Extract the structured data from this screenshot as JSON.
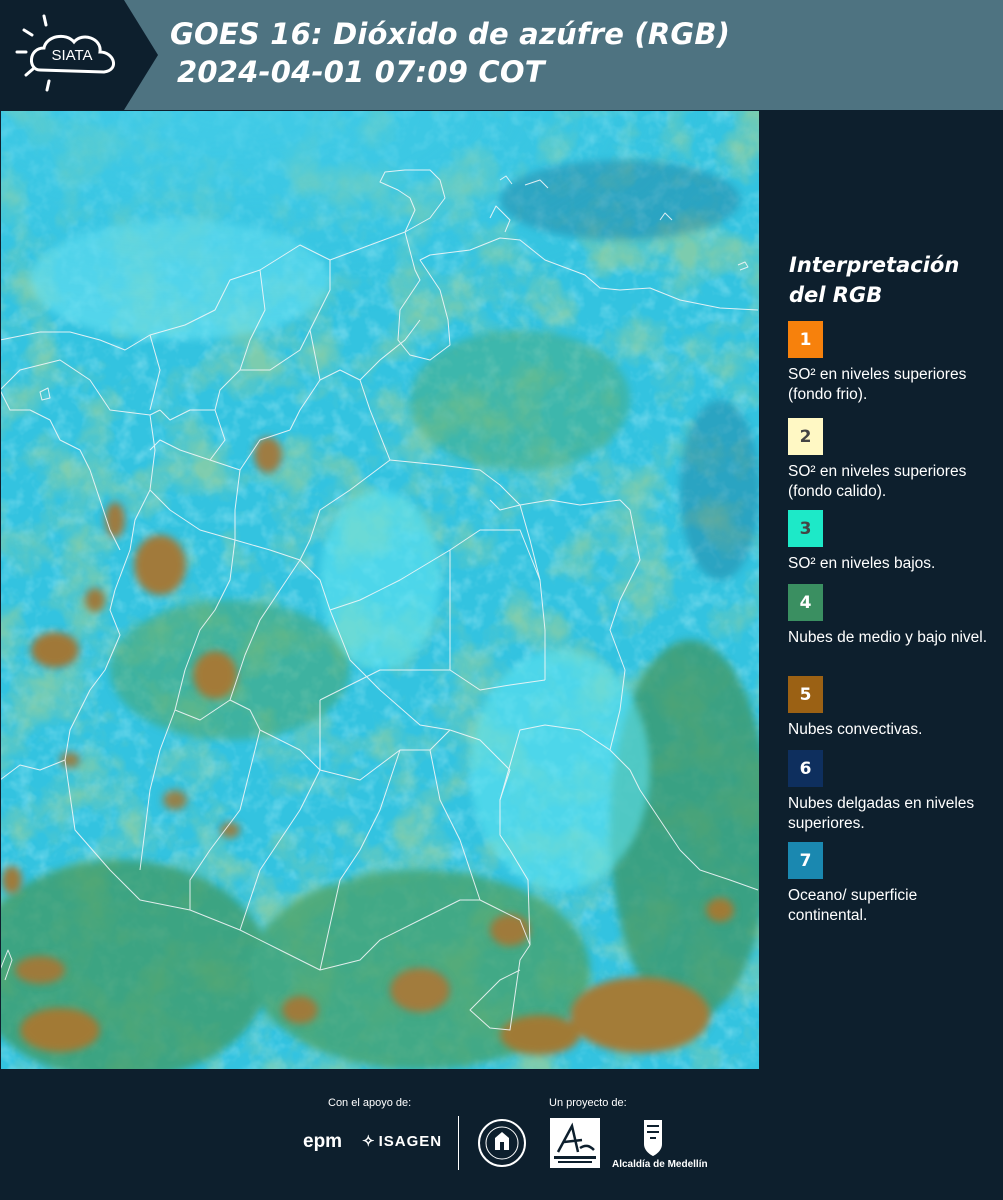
{
  "header": {
    "logo_text": "SIATA",
    "title_line1": "GOES 16: Dióxido de azúfre (RGB)",
    "title_line2": "2024-04-01 07:09 COT"
  },
  "legend": {
    "title": "Interpretación del RGB",
    "items": [
      {
        "number": "1",
        "color": "#f7810c",
        "text": "SO² en niveles superiores (fondo frio)."
      },
      {
        "number": "2",
        "color": "#fff8c4",
        "text": "SO² en niveles superiores (fondo calido)."
      },
      {
        "number": "3",
        "color": "#1de9c8",
        "text": "SO² en niveles bajos."
      },
      {
        "number": "4",
        "color": "#3a8f61",
        "text": "Nubes de medio y bajo nivel."
      },
      {
        "number": "5",
        "color": "#9b6114",
        "text": "Nubes convectivas."
      },
      {
        "number": "6",
        "color": "#0e2f5e",
        "text": "Nubes delgadas en niveles superiores."
      },
      {
        "number": "7",
        "color": "#1a88b0",
        "text": "Oceano/ superficie continental."
      }
    ]
  },
  "footer": {
    "support_caption": "Con el apoyo de:",
    "project_caption": "Un proyecto de:",
    "logos": [
      "epm",
      "ISAGEN",
      "Área Metropolitana Valle de Aburrá",
      "Alcaldía de Medellín"
    ],
    "isagen_label": "ISAGEN",
    "epm_label": "epm",
    "alcaldia_label": "Alcaldía de Medellín"
  },
  "colors": {
    "header_bg": "#4e7381",
    "panel_bg": "#0d1f2d",
    "map_cyan": "#2fc7e6",
    "map_green": "#3f9e6a",
    "map_brown": "#a07a35"
  }
}
